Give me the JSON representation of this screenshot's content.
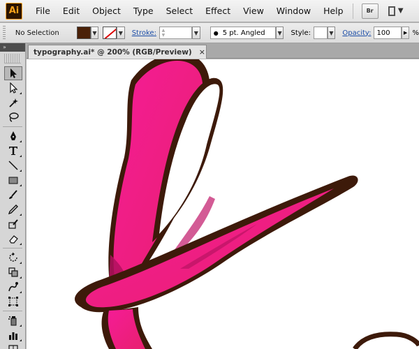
{
  "app": {
    "logo": "Ai"
  },
  "menu": {
    "items": [
      "File",
      "Edit",
      "Object",
      "Type",
      "Select",
      "Effect",
      "View",
      "Window",
      "Help"
    ],
    "bridge_label": "Br"
  },
  "control_bar": {
    "selection": "No Selection",
    "fill_color": "#4a2108",
    "stroke_label": "Stroke:",
    "brush": "5 pt. Angled",
    "style_label": "Style:",
    "opacity_label": "Opacity:",
    "opacity_value": "100",
    "opacity_unit": "%"
  },
  "document": {
    "tab_title": "typography.ai* @ 200% (RGB/Preview)",
    "close_glyph": "×"
  },
  "artwork": {
    "fill_color": "#ee1e85",
    "shadow_color": "#b0105e",
    "outline_color": "#3d1a0a"
  },
  "toolbox": {
    "tools": [
      "selection-icon",
      "direct-selection-icon",
      "magic-wand-icon",
      "lasso-icon",
      "pen-icon",
      "type-icon",
      "line-segment-icon",
      "rectangle-icon",
      "paintbrush-icon",
      "pencil-icon",
      "blob-brush-icon",
      "eraser-icon",
      "rotate-icon",
      "scale-icon",
      "warp-icon",
      "free-transform-icon",
      "symbol-sprayer-icon",
      "column-graph-icon",
      "mesh-icon"
    ]
  }
}
